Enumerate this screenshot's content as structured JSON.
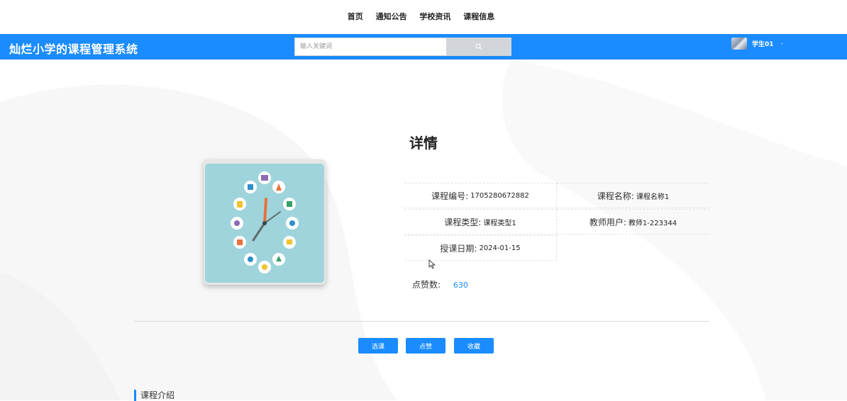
{
  "nav": {
    "items": [
      "首页",
      "通知公告",
      "学校资讯",
      "课程信息"
    ]
  },
  "header": {
    "brand": "灿烂小学的课程管理系统",
    "search_placeholder": "输入关键词",
    "user_name": "学生01",
    "user_caret": "-"
  },
  "detail": {
    "title": "详情",
    "fields": [
      {
        "label": "课程编号:",
        "value": "1705280672882"
      },
      {
        "label": "课程名称:",
        "value": "课程名称1"
      },
      {
        "label": "课程类型:",
        "value": "课程类型1"
      },
      {
        "label": "教师用户:",
        "value": "教师1-223344"
      },
      {
        "label": "授课日期:",
        "value": "2024-01-15"
      }
    ],
    "likes_label": "点赞数:",
    "likes_value": "630"
  },
  "actions": {
    "select": "选课",
    "like": "点赞",
    "favorite": "收藏"
  },
  "section": {
    "intro": "课程介绍"
  },
  "icons": {
    "search": "search-icon",
    "clock_image": "clock-education-illustration",
    "cursor": "mouse-cursor-icon"
  },
  "colors": {
    "accent": "#1a8cff",
    "search_button": "#d2d5d9",
    "image_bg": "#9fd4dc"
  }
}
